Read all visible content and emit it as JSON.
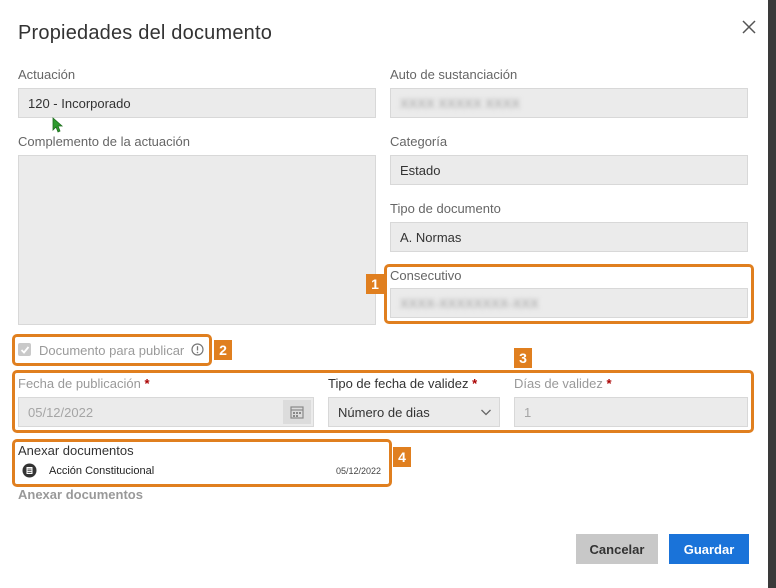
{
  "dialog": {
    "title": "Propiedades del documento"
  },
  "actuacion": {
    "label": "Actuación",
    "value": "120 - Incorporado"
  },
  "auto": {
    "label": "Auto de sustanciación",
    "value": "XXXX XXXXX XXXX"
  },
  "complemento": {
    "label": "Complemento de la actuación",
    "value": ""
  },
  "categoria": {
    "label": "Categoría",
    "value": "Estado"
  },
  "tipo_documento": {
    "label": "Tipo de documento",
    "value": "A. Normas"
  },
  "consecutivo": {
    "label": "Consecutivo",
    "value": "XXXX-XXXXXXXX-XXX"
  },
  "publicar": {
    "label": "Documento para publicar",
    "checked": true
  },
  "fecha_publicacion": {
    "label": "Fecha de publicación",
    "required_mark": "*",
    "value": "05/12/2022"
  },
  "tipo_fecha": {
    "label": "Tipo de fecha de validez",
    "required_mark": "*",
    "value": "Número de dias"
  },
  "dias_validez": {
    "label": "Días de validez",
    "required_mark": "*",
    "value": "1"
  },
  "anexar": {
    "label": "Anexar documentos",
    "items": [
      {
        "name": "Acción Constitucional",
        "date": "05/12/2022",
        "icon": "document-icon"
      }
    ],
    "label2": "Anexar documentos"
  },
  "annotations": {
    "n1": "1",
    "n2": "2",
    "n3": "3",
    "n4": "4",
    "color": "#e07f1f"
  },
  "buttons": {
    "cancel": "Cancelar",
    "save": "Guardar",
    "save_color": "#1a73d9",
    "cancel_color": "#c8c8c8"
  }
}
